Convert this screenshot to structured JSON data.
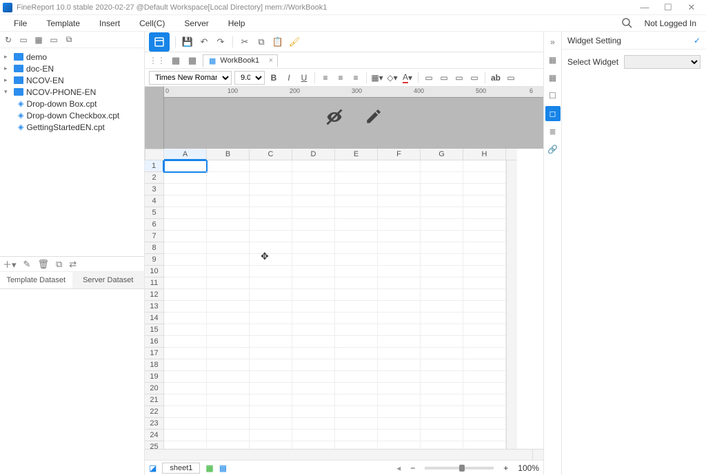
{
  "titlebar": {
    "text": "FineReport 10.0 stable 2020-02-27  @Default Workspace[Local Directory]    mem://WorkBook1"
  },
  "menubar": {
    "items": [
      "File",
      "Template",
      "Insert",
      "Cell(C)",
      "Server",
      "Help"
    ],
    "login": "Not Logged In"
  },
  "tree": {
    "folders": [
      {
        "label": "demo",
        "expanded": false
      },
      {
        "label": "doc-EN",
        "expanded": false
      },
      {
        "label": "NCOV-EN",
        "expanded": false
      },
      {
        "label": "NCOV-PHONE-EN",
        "expanded": true,
        "children": [
          {
            "label": "Drop-down Box.cpt"
          },
          {
            "label": "Drop-down Checkbox.cpt"
          },
          {
            "label": "GettingStartedEN.cpt"
          }
        ]
      }
    ]
  },
  "dataset": {
    "tab1": "Template Dataset",
    "tab2": "Server Dataset"
  },
  "workbook": {
    "tab_label": "WorkBook1",
    "font_name": "Times New Roman",
    "font_size": "9.0",
    "columns": [
      "A",
      "B",
      "C",
      "D",
      "E",
      "F",
      "G",
      "H"
    ],
    "row_count": 26,
    "selected_cell": "A1",
    "ruler": [
      "0",
      "100",
      "200",
      "300",
      "400",
      "500",
      "6"
    ],
    "sheet_tab": "sheet1",
    "zoom": "100%"
  },
  "right_panel": {
    "title": "Widget Setting",
    "select_label": "Select Widget"
  }
}
